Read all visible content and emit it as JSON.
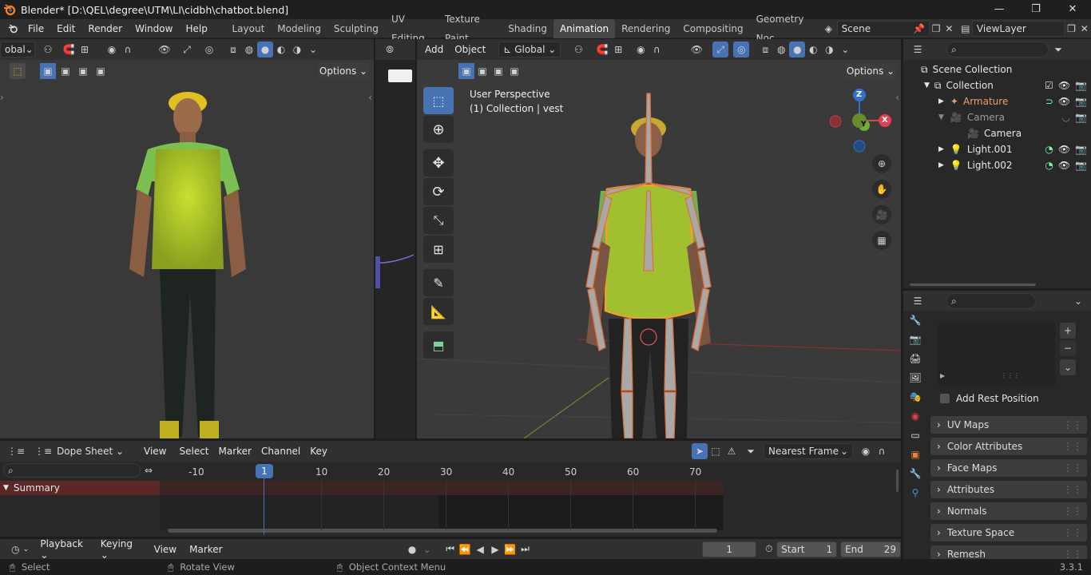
{
  "window": {
    "title": "Blender* [D:\\QEL\\degree\\UTM\\LI\\cidbh\\chatbot.blend]",
    "controls": [
      "—",
      "❐",
      "✕"
    ]
  },
  "menu": [
    "File",
    "Edit",
    "Render",
    "Window",
    "Help"
  ],
  "workspaces": [
    "Layout",
    "Modeling",
    "Sculpting",
    "UV Editing",
    "Texture Paint",
    "Shading",
    "Animation",
    "Rendering",
    "Compositing",
    "Geometry Noc"
  ],
  "scene": {
    "name": "Scene",
    "viewlayer": "ViewLayer"
  },
  "left_view": {
    "orientation": "obal",
    "options": "Options"
  },
  "main_view": {
    "menu_add": "Add",
    "menu_object": "Object",
    "orientation": "Global",
    "options": "Options",
    "perspective": "User Perspective",
    "collection_info": "(1) Collection | vest",
    "gizmo_z": "Z",
    "gizmo_y": "Y",
    "gizmo_x": "X"
  },
  "outliner": {
    "root": "Scene Collection",
    "collection": "Collection",
    "items": [
      {
        "name": "Armature",
        "highlight": "#e8a070"
      },
      {
        "name": "Camera",
        "highlight": "#9a9a9a"
      },
      {
        "name": "Camera",
        "highlight": "#dddddd"
      },
      {
        "name": "Light.001",
        "highlight": "#dddddd"
      },
      {
        "name": "Light.002",
        "highlight": "#dddddd"
      }
    ]
  },
  "properties": {
    "add_rest": "Add Rest Position",
    "panels": [
      "UV Maps",
      "Color Attributes",
      "Face Maps",
      "Attributes",
      "Normals",
      "Texture Space",
      "Remesh"
    ]
  },
  "dopesheet": {
    "mode": "Dope Sheet",
    "menus": [
      "View",
      "Select",
      "Marker",
      "Channel",
      "Key"
    ],
    "snap": "Nearest Frame",
    "summary": "Summary",
    "current_frame": "1",
    "ticks": [
      "-10",
      "10",
      "20",
      "30",
      "40",
      "50",
      "60",
      "70"
    ]
  },
  "timeline": {
    "menus": [
      "Playback",
      "Keying",
      "View",
      "Marker"
    ],
    "frame": "1",
    "start_label": "Start",
    "start": "1",
    "end_label": "End",
    "end": "29"
  },
  "status": {
    "select": "Select",
    "rotate": "Rotate View",
    "context": "Object Context Menu",
    "version": "3.3.1"
  },
  "colors": {
    "accent": "#4772b3",
    "selected_orange": "#f0a030",
    "armature": "#e8a070"
  }
}
